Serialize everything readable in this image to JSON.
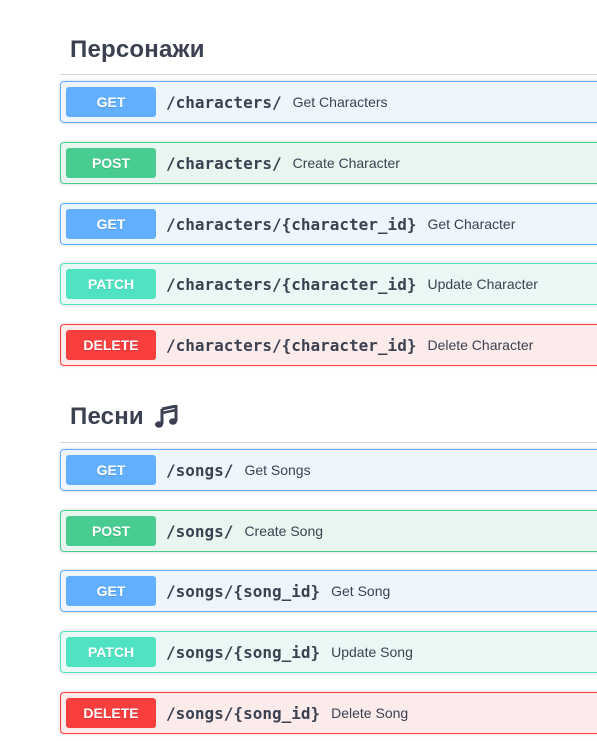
{
  "sections": [
    {
      "title": "Персонажи",
      "operations": [
        {
          "method": "GET",
          "path": "/characters/",
          "summary": "Get Characters"
        },
        {
          "method": "POST",
          "path": "/characters/",
          "summary": "Create Character"
        },
        {
          "method": "GET",
          "path": "/characters/{character_id}",
          "summary": "Get Character"
        },
        {
          "method": "PATCH",
          "path": "/characters/{character_id}",
          "summary": "Update Character"
        },
        {
          "method": "DELETE",
          "path": "/characters/{character_id}",
          "summary": "Delete Character"
        }
      ]
    },
    {
      "title": "Песни",
      "icon": "musical-notes-icon",
      "operations": [
        {
          "method": "GET",
          "path": "/songs/",
          "summary": "Get Songs"
        },
        {
          "method": "POST",
          "path": "/songs/",
          "summary": "Create Song"
        },
        {
          "method": "GET",
          "path": "/songs/{song_id}",
          "summary": "Get Song"
        },
        {
          "method": "PATCH",
          "path": "/songs/{song_id}",
          "summary": "Update Song"
        },
        {
          "method": "DELETE",
          "path": "/songs/{song_id}",
          "summary": "Delete Song"
        }
      ]
    }
  ],
  "colors": {
    "get": "#61affe",
    "post": "#49cc90",
    "patch": "#50e3c2",
    "delete": "#f93e3e",
    "text": "#3b4151"
  }
}
